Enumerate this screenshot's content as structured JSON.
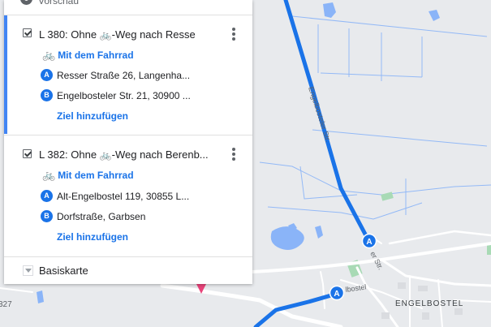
{
  "panel": {
    "preview_label": "Vorschau",
    "layers": [
      {
        "title": "L 380: Ohne 🚲-Weg nach Resse",
        "title_prefix": "L 380: Ohne ",
        "title_suffix": "-Weg nach Resse",
        "mode": "Mit dem Fahrrad",
        "stops": [
          {
            "badge": "A",
            "address": "Resser Straße 26, Langenha..."
          },
          {
            "badge": "B",
            "address": "Engelbosteler Str. 21, 30900 ..."
          }
        ],
        "add_destination": "Ziel hinzufügen",
        "checked": true
      },
      {
        "title": "L 382: Ohne 🚲-Weg nach Berenb...",
        "title_prefix": "L 382: Ohne ",
        "title_suffix": "-Weg nach Berenb...",
        "mode": "Mit dem Fahrrad",
        "stops": [
          {
            "badge": "A",
            "address": "Alt-Engelbostel 119, 30855 L..."
          },
          {
            "badge": "B",
            "address": "Dorfstraße, Garbsen"
          }
        ],
        "add_destination": "Ziel hinzufügen",
        "checked": true
      }
    ],
    "basemap_label": "Basiskarte"
  },
  "map": {
    "place_label": "ENGELBOSTEL",
    "street_label_1": "Engelbosteler Str.",
    "street_label_2": "er Str.",
    "street_label_3": "lbostel",
    "edge_label": "327",
    "markers": [
      {
        "badge": "A"
      },
      {
        "badge": "A"
      }
    ],
    "route_color": "#1a73e8"
  },
  "icons": {
    "bike_red": "🚲",
    "bike_blue": "🚲"
  }
}
